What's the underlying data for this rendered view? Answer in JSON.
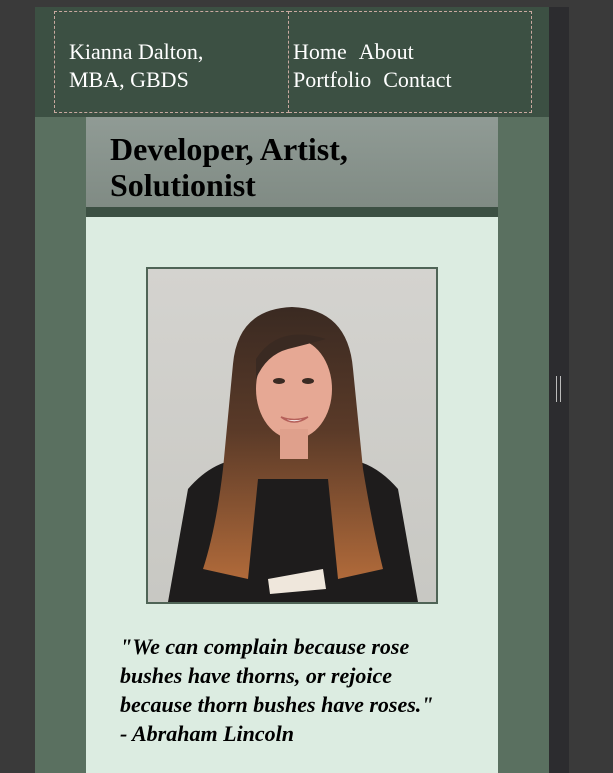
{
  "header": {
    "brand_line1": "Kianna Dalton,",
    "brand_line2": "MBA, GBDS",
    "nav": {
      "home": "Home",
      "about": "About",
      "portfolio": "Portfolio",
      "contact": "Contact"
    }
  },
  "hero": {
    "title_line1": "Developer, Artist,",
    "title_line2": "Solutionist"
  },
  "quote": {
    "line1": "\"We can complain because rose",
    "line2": "bushes have thorns, or rejoice",
    "line3": "because thorn bushes have roses.\"",
    "line4": "- Abraham Lincoln"
  },
  "colors": {
    "header_bg": "#3c5043",
    "page_bg": "#5a7060",
    "content_bg": "#dcece1",
    "title_bar_bg": "#8a958f"
  },
  "icons": {
    "resize": "resize-handle-icon"
  }
}
